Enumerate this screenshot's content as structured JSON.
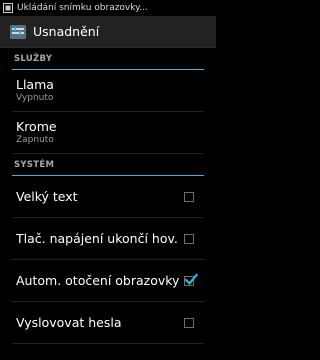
{
  "status_bar": {
    "notification_text": "Ukládání snímku obrazovky..."
  },
  "action_bar": {
    "title": "Usnadnění"
  },
  "sections": {
    "services": {
      "header": "SLUŽBY",
      "items": [
        {
          "title": "Llama",
          "status": "Vypnuto"
        },
        {
          "title": "Krome",
          "status": "Zapnuto"
        }
      ]
    },
    "system": {
      "header": "SYSTÉM",
      "items": [
        {
          "title": "Velký text",
          "checked": false
        },
        {
          "title": "Tlač. napájení ukončí hov.",
          "checked": false
        },
        {
          "title": "Autom. otočení obrazovky",
          "checked": true
        },
        {
          "title": "Vyslovovat hesla",
          "checked": false
        }
      ]
    }
  },
  "colors": {
    "accent": "#33b5e5",
    "background": "#000000",
    "actionbar": "#222222"
  }
}
